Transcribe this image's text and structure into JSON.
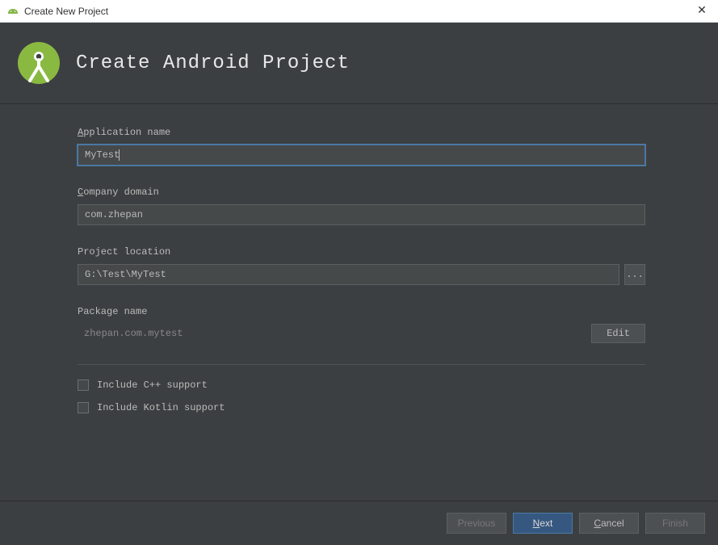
{
  "window": {
    "title": "Create New Project",
    "close_glyph": "✕"
  },
  "header": {
    "title": "Create Android Project"
  },
  "fields": {
    "app_name": {
      "label": "Application name",
      "value": "MyTest"
    },
    "company_domain": {
      "label": "Company domain",
      "value": "com.zhepan"
    },
    "project_location": {
      "label": "Project location",
      "value": "G:\\Test\\MyTest",
      "browse": "..."
    },
    "package_name": {
      "label": "Package name",
      "value": "zhepan.com.mytest",
      "edit_label": "Edit"
    },
    "include_cpp": {
      "label": "Include C++ support",
      "checked": false
    },
    "include_kotlin": {
      "label": "Include Kotlin support",
      "checked": false
    }
  },
  "footer": {
    "previous": "Previous",
    "next_prefix": "N",
    "next_rest": "ext",
    "cancel_prefix": "C",
    "cancel_rest": "ancel",
    "finish": "Finish"
  }
}
